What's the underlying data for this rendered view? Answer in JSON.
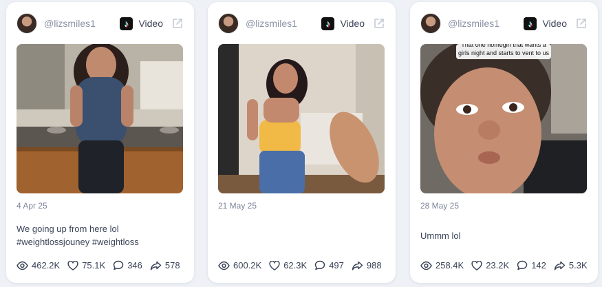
{
  "colors": {
    "background": "#eef1f6",
    "card": "#ffffff",
    "muted_text": "#8a93a6",
    "text": "#3b4458"
  },
  "cards": [
    {
      "handle": "@lizsmiles1",
      "platform_icon": "tiktok-icon",
      "type_label": "Video",
      "date": "4 Apr 25",
      "caption": "We going up from here lol #weightlossjouney #weightloss",
      "stats": {
        "views": "462.2K",
        "likes": "75.1K",
        "comments": "346",
        "shares": "578"
      }
    },
    {
      "handle": "@lizsmiles1",
      "platform_icon": "tiktok-icon",
      "type_label": "Video",
      "date": "21 May 25",
      "caption": "",
      "stats": {
        "views": "600.2K",
        "likes": "62.3K",
        "comments": "497",
        "shares": "988"
      }
    },
    {
      "handle": "@lizsmiles1",
      "platform_icon": "tiktok-icon",
      "type_label": "Video",
      "date": "28 May 25",
      "thumbnail_overlay": "That one homegirl that wants a girls night and starts to vent to us",
      "caption": "Ummm lol",
      "stats": {
        "views": "258.4K",
        "likes": "23.2K",
        "comments": "142",
        "shares": "5.3K"
      }
    }
  ]
}
